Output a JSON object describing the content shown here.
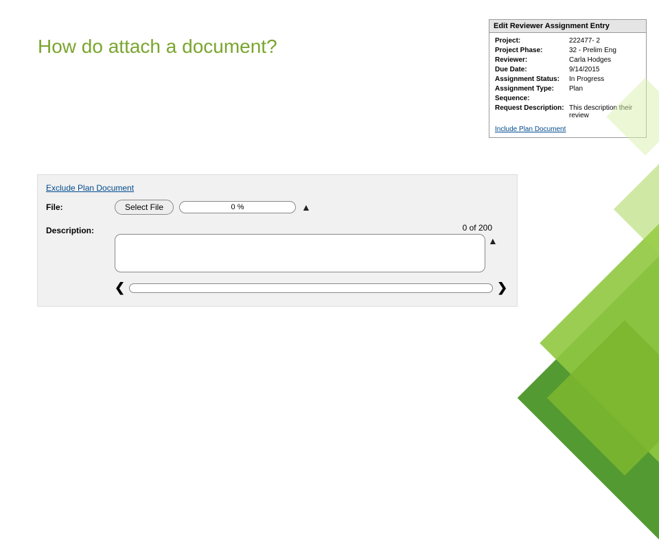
{
  "title": "How do attach a document?",
  "panel": {
    "header": "Edit Reviewer Assignment Entry",
    "rows": [
      {
        "label": "Project:",
        "value": "222477-  2"
      },
      {
        "label": "Project Phase:",
        "value": "32 - Prelim Eng"
      },
      {
        "label": "Reviewer:",
        "value": "Carla Hodges"
      },
      {
        "label": "Due Date:",
        "value": "9/14/2015"
      },
      {
        "label": "Assignment Status:",
        "value": "In Progress"
      },
      {
        "label": "Assignment Type:",
        "value": "Plan"
      },
      {
        "label": "Sequence:",
        "value": ""
      },
      {
        "label": "Request Description:",
        "value": "This description their review"
      }
    ],
    "link": "Include Plan Document"
  },
  "form": {
    "exclude_link": "Exclude Plan Document",
    "file_label": "File:",
    "select_file": "Select File",
    "progress": "0 %",
    "description_label": "Description:",
    "char_count": "0 of 200",
    "nav_prev": "❮",
    "nav_next": "❯"
  }
}
